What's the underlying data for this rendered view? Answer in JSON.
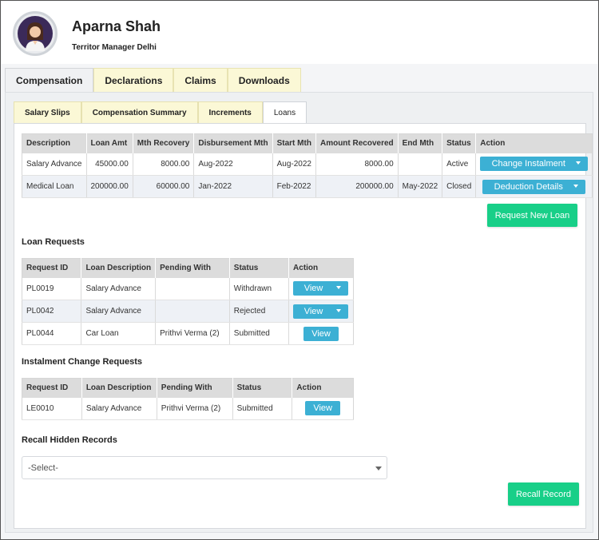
{
  "profile": {
    "name": "Aparna Shah",
    "role": "Territor Manager Delhi"
  },
  "main_tabs": [
    "Compensation",
    "Declarations",
    "Claims",
    "Downloads"
  ],
  "sub_tabs": [
    "Salary Slips",
    "Compensation Summary",
    "Increments",
    "Loans"
  ],
  "loans": {
    "headers": [
      "Description",
      "Loan Amt",
      "Mth Recovery",
      "Disbursement Mth",
      "Start Mth",
      "Amount Recovered",
      "End Mth",
      "Status",
      "Action"
    ],
    "rows": [
      {
        "description": "Salary Advance",
        "loan_amt": "45000.00",
        "mth_recovery": "8000.00",
        "disbursement": "Aug-2022",
        "start": "Aug-2022",
        "recovered": "8000.00",
        "end": "",
        "status": "Active",
        "action": "Change Instalment"
      },
      {
        "description": "Medical Loan",
        "loan_amt": "200000.00",
        "mth_recovery": "60000.00",
        "disbursement": "Jan-2022",
        "start": "Feb-2022",
        "recovered": "200000.00",
        "end": "May-2022",
        "status": "Closed",
        "action": "Deduction Details"
      }
    ],
    "request_new_label": "Request New Loan"
  },
  "loan_requests": {
    "title": "Loan Requests",
    "headers": [
      "Request ID",
      "Loan Description",
      "Pending With",
      "Status",
      "Action"
    ],
    "rows": [
      {
        "id": "PL0019",
        "description": "Salary Advance",
        "pending": "",
        "status": "Withdrawn",
        "action": "View"
      },
      {
        "id": "PL0042",
        "description": "Salary Advance",
        "pending": "",
        "status": "Rejected",
        "action": "View"
      },
      {
        "id": "PL0044",
        "description": "Car Loan",
        "pending": "Prithvi Verma (2)",
        "status": "Submitted",
        "action": "View"
      }
    ]
  },
  "instalment_requests": {
    "title": "Instalment Change Requests",
    "headers": [
      "Request ID",
      "Loan Description",
      "Pending With",
      "Status",
      "Action"
    ],
    "rows": [
      {
        "id": "LE0010",
        "description": "Salary Advance",
        "pending": "Prithvi Verma (2)",
        "status": "Submitted",
        "action": "View"
      }
    ]
  },
  "recall": {
    "title": "Recall Hidden Records",
    "select_value": "-Select-",
    "button_label": "Recall Record"
  },
  "colors": {
    "accent_blue": "#3cb0d4",
    "accent_green": "#18cf88",
    "tab_yellow": "#fbf8d6"
  }
}
